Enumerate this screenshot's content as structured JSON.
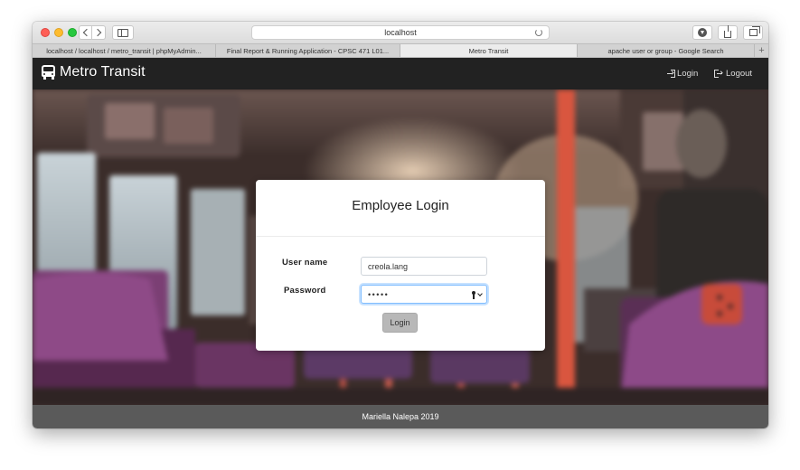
{
  "browser": {
    "address": "localhost",
    "tabs": [
      {
        "label": "localhost / localhost / metro_transit | phpMyAdmin..."
      },
      {
        "label": "Final Report & Running Application - CPSC 471 L01..."
      },
      {
        "label": "Metro Transit"
      },
      {
        "label": "apache user or group - Google Search"
      }
    ],
    "new_tab_label": "+"
  },
  "site": {
    "brand": "Metro Transit",
    "nav": {
      "login": "Login",
      "logout": "Logout"
    }
  },
  "login_card": {
    "title": "Employee Login",
    "username_label": "User name",
    "username_value": "creola.lang",
    "password_label": "Password",
    "password_masked": "•••••",
    "submit_label": "Login"
  },
  "footer": {
    "text": "Mariella Nalepa 2019"
  },
  "colors": {
    "navbar": "#222222",
    "footer": "#5a5a5a",
    "focus": "#80bdff",
    "button": "#b8b8b8"
  }
}
